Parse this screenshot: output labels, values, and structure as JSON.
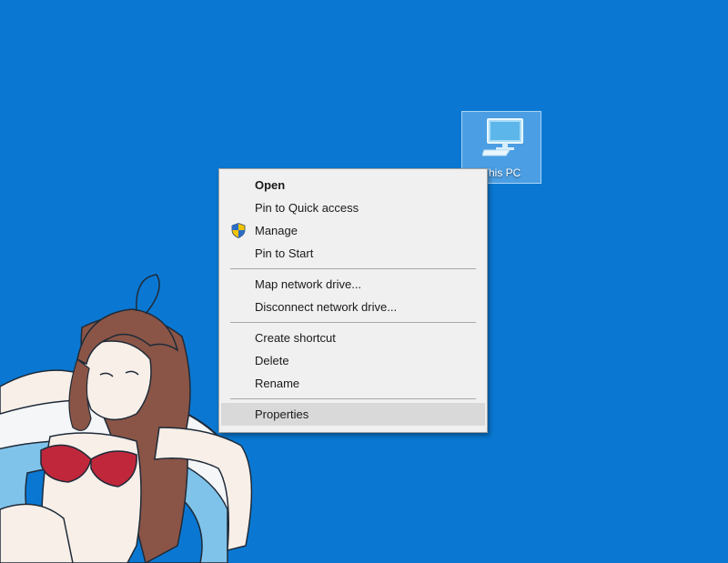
{
  "desktop": {
    "background_color": "#0a78d2",
    "icons": [
      {
        "label": "This PC",
        "icon": "computer-icon",
        "selected": true
      }
    ]
  },
  "context_menu": {
    "groups": [
      [
        {
          "label": "Open",
          "default": true
        },
        {
          "label": "Pin to Quick access"
        },
        {
          "label": "Manage",
          "icon": "uac-shield-icon"
        },
        {
          "label": "Pin to Start"
        }
      ],
      [
        {
          "label": "Map network drive..."
        },
        {
          "label": "Disconnect network drive..."
        }
      ],
      [
        {
          "label": "Create shortcut"
        },
        {
          "label": "Delete"
        },
        {
          "label": "Rename"
        }
      ],
      [
        {
          "label": "Properties",
          "highlighted": true
        }
      ]
    ]
  },
  "colors": {
    "menu_background": "#f0f0f0",
    "menu_highlight": "#d9d9d9",
    "menu_separator": "#a8a8a8",
    "icon_selection": "#82bef0"
  }
}
